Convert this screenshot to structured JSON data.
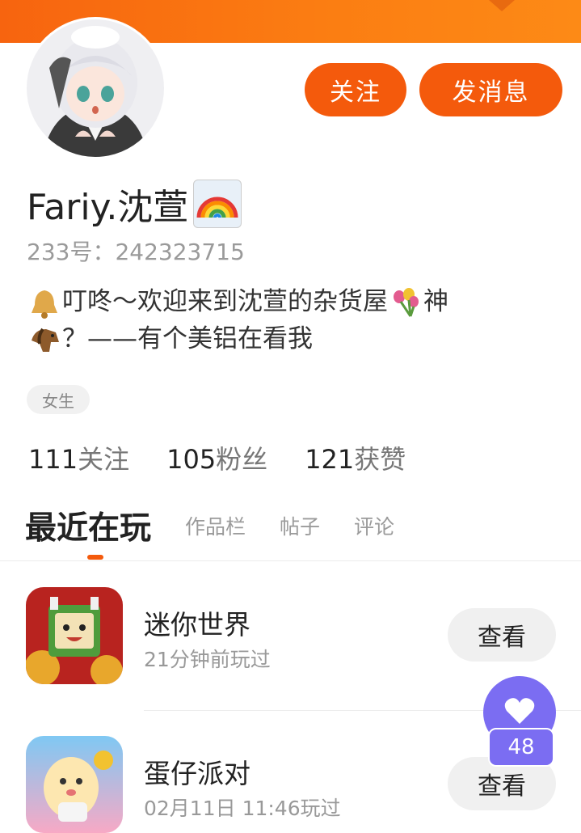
{
  "header": {
    "follow_label": "关注",
    "message_label": "发消息"
  },
  "profile": {
    "name": "Fariy.沈萱",
    "name_emoji": "rainbow-emoji",
    "uid_label": "233号：242323715",
    "bio_line1": "叮咚～欢迎来到沈萱的杂货屋",
    "bio_line1_tail": "神",
    "bio_line2": "？——有个美铝在看我",
    "gender": "女生"
  },
  "stats": [
    {
      "num": "111",
      "label": "关注"
    },
    {
      "num": "105",
      "label": "粉丝"
    },
    {
      "num": "121",
      "label": "获赞"
    }
  ],
  "tabs": [
    "最近在玩",
    "作品栏",
    "帖子",
    "评论"
  ],
  "games": [
    {
      "title": "迷你世界",
      "time": "21分钟前玩过",
      "action": "查看"
    },
    {
      "title": "蛋仔派对",
      "time": "02月11日 11:46玩过",
      "action": "查看"
    }
  ],
  "like_count": "48",
  "colors": {
    "accent": "#f45a0c",
    "banner": "#fb7d12",
    "like": "#7b6df2"
  }
}
